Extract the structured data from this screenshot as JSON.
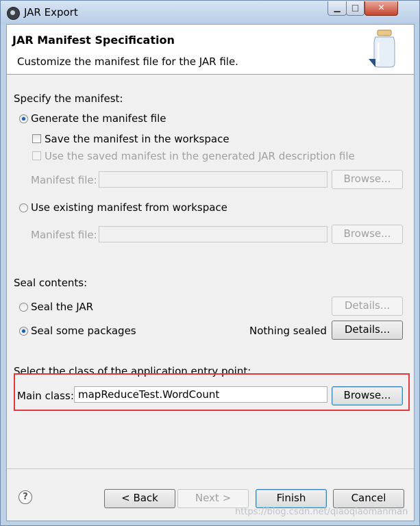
{
  "window": {
    "title": "JAR Export",
    "controls": {
      "minimize": "▁",
      "maximize": "□",
      "close": "✕"
    }
  },
  "banner": {
    "heading": "JAR Manifest Specification",
    "description": "Customize the manifest file for the JAR file."
  },
  "manifest": {
    "section_label": "Specify the manifest:",
    "generate_label": "Generate the manifest file",
    "save_label": "Save the manifest in the workspace",
    "use_saved_label": "Use the saved manifest in the generated JAR description file",
    "manifest_file_label": "Manifest file:",
    "browse_label": "Browse...",
    "use_existing_label": "Use existing manifest from workspace",
    "existing_file_label": "Manifest file:",
    "existing_browse_label": "Browse..."
  },
  "seal": {
    "section_label": "Seal contents:",
    "seal_jar_label": "Seal the JAR",
    "seal_jar_details": "Details...",
    "seal_packages_label": "Seal some packages",
    "status": "Nothing sealed",
    "seal_packages_details": "Details..."
  },
  "entry": {
    "section_label": "Select the class of the application entry point:",
    "main_class_label": "Main class:",
    "main_class_value": "mapReduceTest.WordCount",
    "browse_label": "Browse..."
  },
  "footer": {
    "help": "?",
    "back": "< Back",
    "next": "Next >",
    "finish": "Finish",
    "cancel": "Cancel"
  },
  "watermark": "https://blog.csdn.net/qiaoqiaomanman"
}
